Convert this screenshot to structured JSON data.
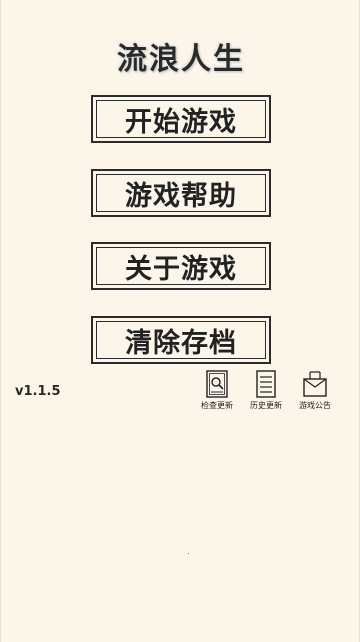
{
  "title": "流浪人生",
  "menu": {
    "start": "开始游戏",
    "help": "游戏帮助",
    "about": "关于游戏",
    "clear": "清除存档"
  },
  "version": "v1.1.5",
  "tools": {
    "check_update": {
      "label": "检查更新",
      "icon": "magnifier-document-icon"
    },
    "history": {
      "label": "历史更新",
      "icon": "document-lines-icon"
    },
    "notice": {
      "label": "游戏公告",
      "icon": "envelope-icon"
    }
  },
  "colors": {
    "background": "#fbf6e9",
    "ink": "#2b2b2b"
  }
}
